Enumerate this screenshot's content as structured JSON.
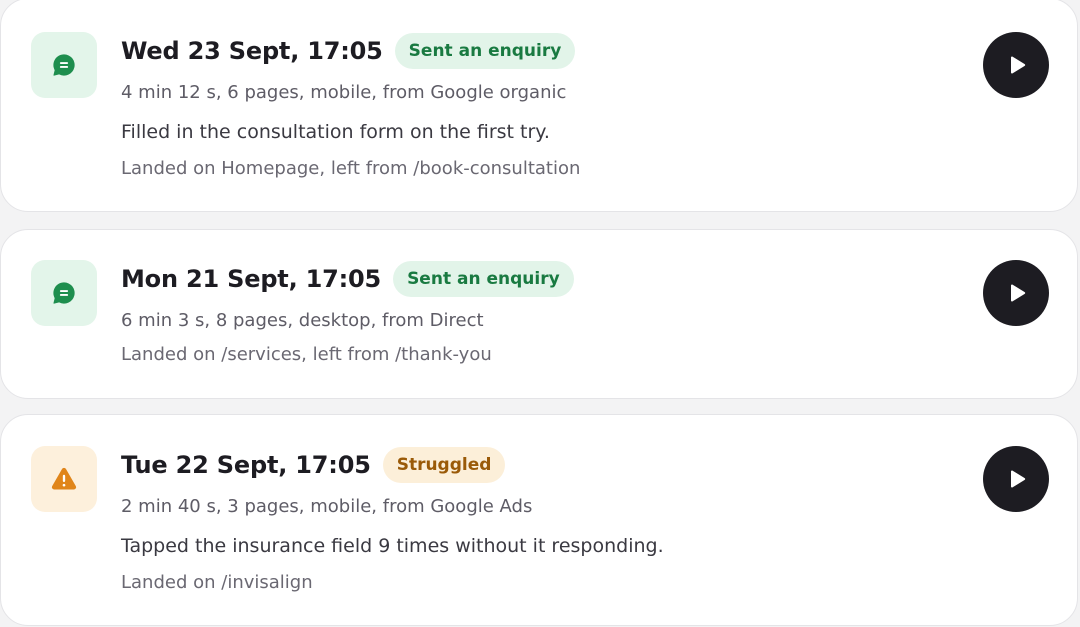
{
  "colors": {
    "success_bg": "#e3f5ea",
    "success_icon": "#1e8e4e",
    "success_text": "#197a41",
    "warning_bg": "#fdf0dc",
    "warning_icon": "#e0851a",
    "warning_text": "#9a5a08",
    "play_button": "#1d1c22"
  },
  "sessions": [
    {
      "icon": "chat-bubble-icon",
      "status": "success",
      "title": "Wed 23 Sept, 17:05",
      "badge": "Sent an enquiry",
      "meta": "4 min 12 s, 6 pages, mobile, from Google organic",
      "description": "Filled in the consultation form on the first try.",
      "path": "Landed on Homepage, left from /book-consultation"
    },
    {
      "icon": "chat-bubble-icon",
      "status": "success",
      "title": "Mon 21 Sept, 17:05",
      "badge": "Sent an enquiry",
      "meta": "6 min 3 s, 8 pages, desktop, from Direct",
      "path": "Landed on /services, left from /thank-you"
    },
    {
      "icon": "warning-triangle-icon",
      "status": "warning",
      "title": "Tue 22 Sept, 17:05",
      "badge": "Struggled",
      "meta": "2 min 40 s, 3 pages, mobile, from Google Ads",
      "description": "Tapped the insurance field 9 times without it responding.",
      "path": "Landed on /invisalign"
    }
  ]
}
